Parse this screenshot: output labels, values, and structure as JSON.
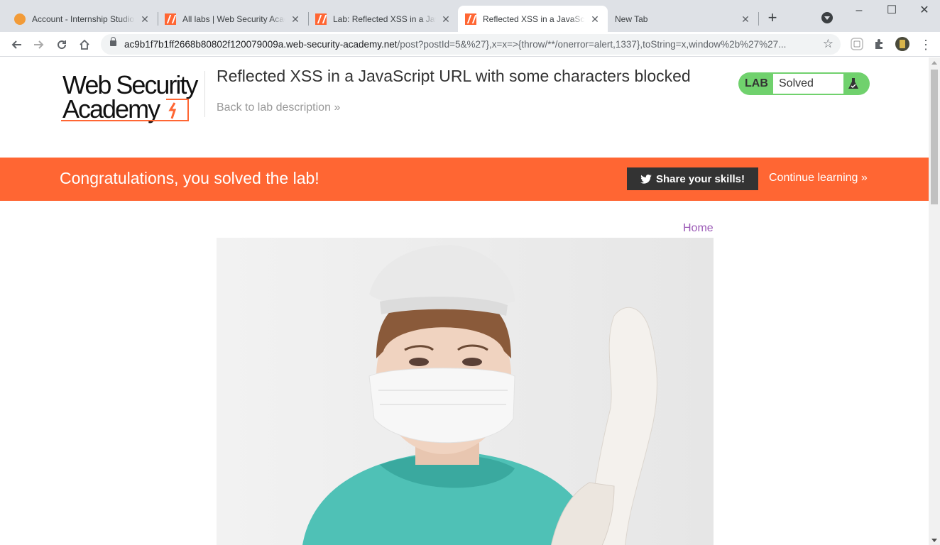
{
  "browser": {
    "tabs": [
      {
        "title": "Account - Internship Studio",
        "active": false,
        "favicon": "internship-studio-icon"
      },
      {
        "title": "All labs | Web Security Academy",
        "active": false,
        "favicon": "burp-icon"
      },
      {
        "title": "Lab: Reflected XSS in a JavaScript URL",
        "active": false,
        "favicon": "burp-icon"
      },
      {
        "title": "Reflected XSS in a JavaScript URL",
        "active": true,
        "favicon": "burp-icon"
      },
      {
        "title": "New Tab",
        "active": false,
        "favicon": ""
      }
    ],
    "url_host": "ac9b1f7b1ff2668b80802f120079009a.web-security-academy.net",
    "url_rest": "/post?postId=5&%27},x=x=>{throw/**/onerror=alert,1337},toString=x,window%2b%27%27..."
  },
  "header": {
    "logo_line1": "Web Security",
    "logo_line2": "Academy",
    "lab_title": "Reflected XSS in a JavaScript URL with some characters blocked",
    "back_link": "Back to lab description",
    "status_tag": "LAB",
    "status_text": "Solved"
  },
  "banner": {
    "message": "Congratulations, you solved the lab!",
    "share_label": "Share your skills!",
    "continue_label": "Continue learning"
  },
  "content": {
    "home_link": "Home"
  },
  "colors": {
    "accent": "#ff6633",
    "status_green": "#70d16d",
    "link_purple": "#9b59b6"
  }
}
